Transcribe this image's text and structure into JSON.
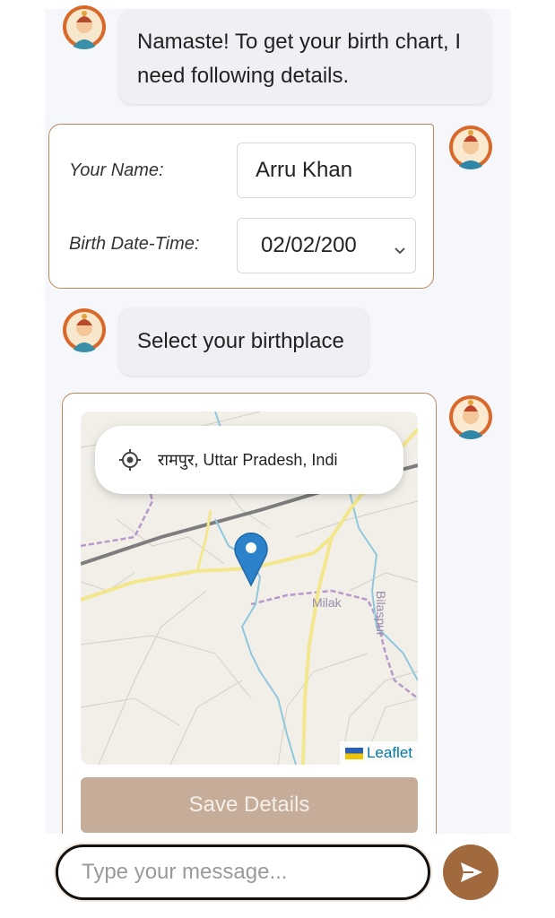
{
  "messages": {
    "greeting": "Namaste! To get your birth chart, I need following details.",
    "birthplace_prompt": "Select your birthplace"
  },
  "form": {
    "name_label": "Your Name:",
    "name_value": "Arru Khan",
    "dob_label": "Birth Date-Time:",
    "dob_value": "02/02/200"
  },
  "map": {
    "location_text": "रामपुर, Uttar Pradesh, Indi",
    "place_milak": "Milak",
    "place_bilaspur": "Bilaspur",
    "attribution": "Leaflet"
  },
  "buttons": {
    "save_label": "Save Details"
  },
  "composer": {
    "placeholder": "Type your message..."
  },
  "colors": {
    "accent": "#a06a3e",
    "card_border": "#b8875c",
    "save_disabled": "#c5ad99"
  },
  "icons": {
    "bot_avatar": "astrologer-avatar-icon",
    "user_avatar": "astrologer-avatar-icon",
    "locate": "locate-crosshair-icon",
    "pin": "map-pin-icon",
    "send": "send-icon",
    "chevron": "chevron-down-icon"
  }
}
